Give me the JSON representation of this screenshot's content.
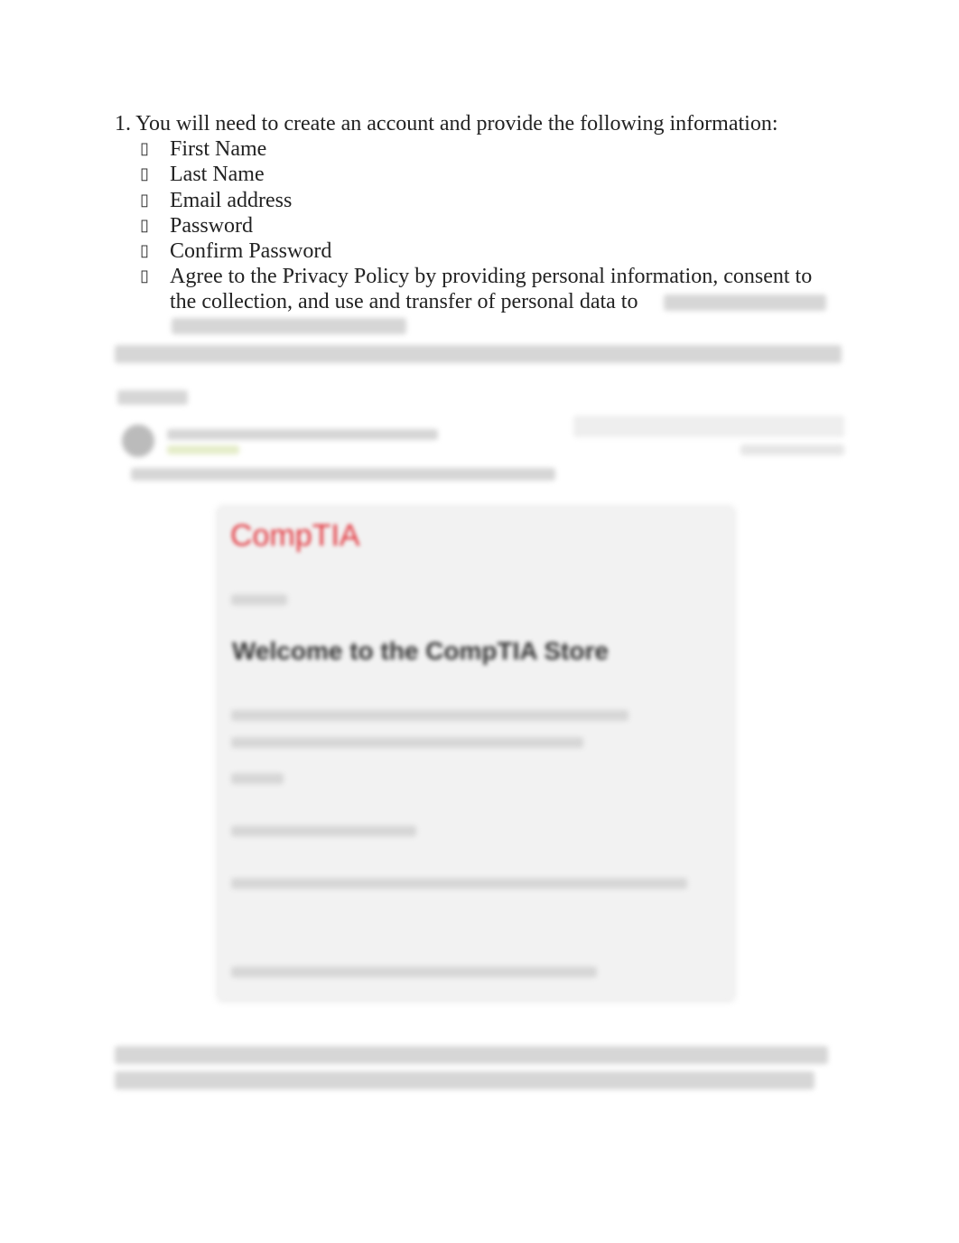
{
  "step1": {
    "intro": "1. You will need to create an account and provide the following information:",
    "bullet_icon": "square-bullet-icon",
    "items": [
      "First Name",
      "Last Name",
      "Email address",
      "Password",
      "Confirm Password"
    ],
    "privacy_line1": "Agree to the Privacy Policy by providing personal information, consent to",
    "privacy_line2": "the collection, and use and transfer of personal data to"
  },
  "email_preview": {
    "brand": "CompTIA",
    "heading": "Welcome to the CompTIA Store",
    "brand_color": "#e2343c"
  }
}
